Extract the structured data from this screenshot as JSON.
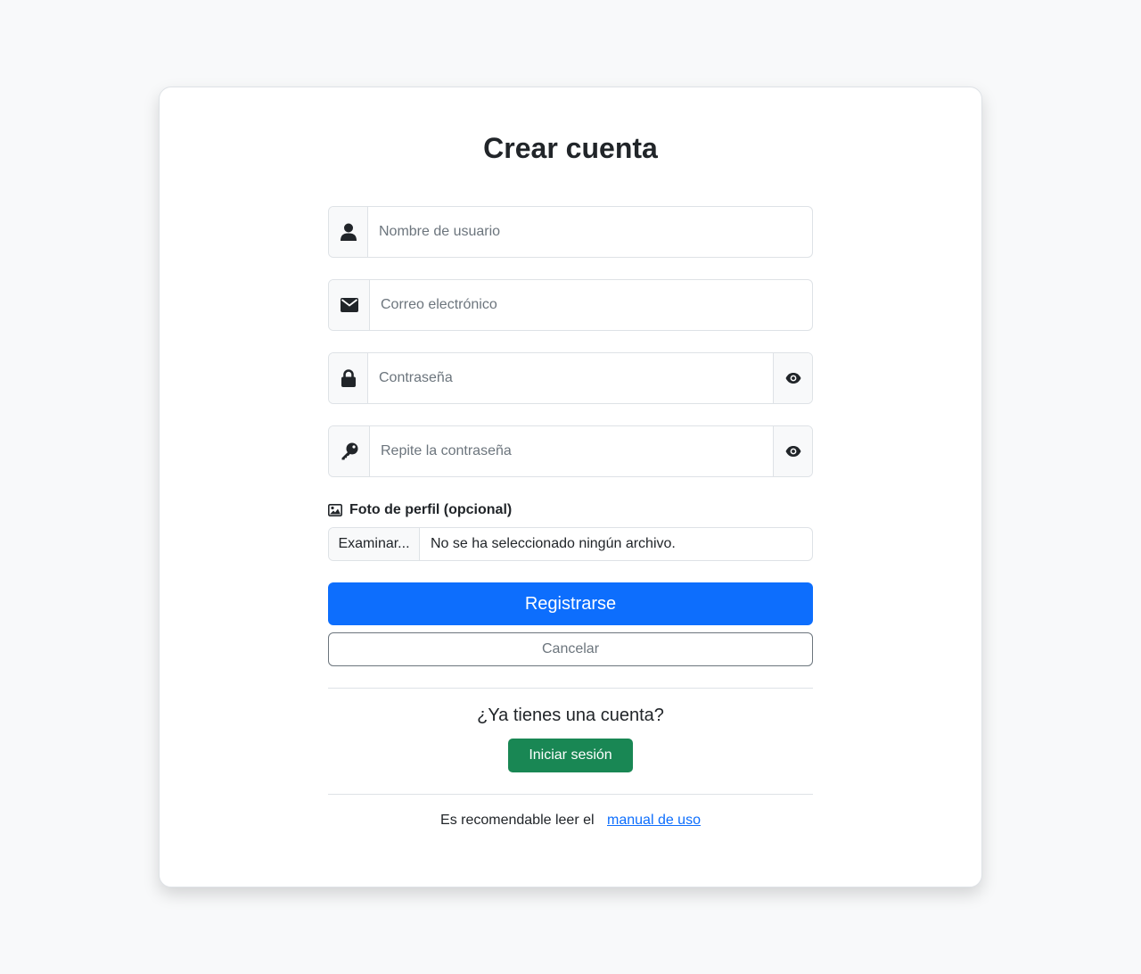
{
  "page": {
    "title": "Crear cuenta"
  },
  "form": {
    "username": {
      "placeholder": "Nombre de usuario",
      "value": "",
      "icon": "user-icon"
    },
    "email": {
      "placeholder": "Correo electrónico",
      "value": "",
      "icon": "envelope-icon"
    },
    "password": {
      "placeholder": "Contraseña",
      "value": "",
      "icon": "lock-icon",
      "toggle_icon": "eye-icon"
    },
    "password_repeat": {
      "placeholder": "Repite la contraseña",
      "value": "",
      "icon": "key-icon",
      "toggle_icon": "eye-icon"
    },
    "photo": {
      "label": "Foto de perfil (opcional)",
      "icon": "image-icon",
      "browse_label": "Examinar...",
      "status": "No se ha seleccionado ningún archivo."
    }
  },
  "actions": {
    "register_label": "Registrarse",
    "cancel_label": "Cancelar"
  },
  "login": {
    "question": "¿Ya tienes una cuenta?",
    "button_label": "Iniciar sesión"
  },
  "footer": {
    "text": "Es recomendable leer el",
    "link_label": "manual de uso"
  },
  "colors": {
    "background": "#f8f9fa",
    "primary": "#0d6efd",
    "success": "#198754",
    "secondary": "#6c757d"
  }
}
